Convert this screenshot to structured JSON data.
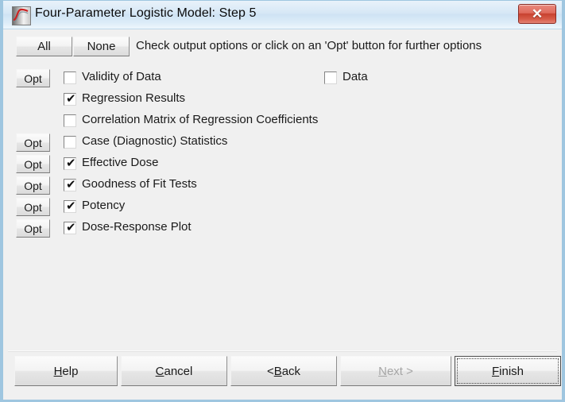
{
  "window": {
    "title": "Four-Parameter Logistic Model: Step 5",
    "icon": "logistic-curve-icon",
    "close_label": "✕"
  },
  "toolbar": {
    "all_label": "All",
    "none_label": "None",
    "hint": "Check output options or click on an 'Opt' button for further options",
    "opt_label": "Opt"
  },
  "options": [
    {
      "opt": true,
      "checked": false,
      "label": "Validity of Data"
    },
    {
      "opt": false,
      "checked": true,
      "label": "Regression Results"
    },
    {
      "opt": false,
      "checked": false,
      "label": "Correlation Matrix of Regression Coefficients"
    },
    {
      "opt": true,
      "checked": false,
      "label": "Case (Diagnostic) Statistics"
    },
    {
      "opt": true,
      "checked": true,
      "label": "Effective Dose"
    },
    {
      "opt": true,
      "checked": true,
      "label": "Goodness of Fit Tests"
    },
    {
      "opt": true,
      "checked": true,
      "label": "Potency"
    },
    {
      "opt": true,
      "checked": true,
      "label": "Dose-Response Plot"
    }
  ],
  "right_option": {
    "checked": false,
    "label": "Data"
  },
  "footer": {
    "help": {
      "pre": "",
      "mn": "H",
      "post": "elp",
      "disabled": false
    },
    "cancel": {
      "pre": "",
      "mn": "C",
      "post": "ancel",
      "disabled": false
    },
    "back": {
      "pre": "< ",
      "mn": "B",
      "post": "ack",
      "disabled": false
    },
    "next": {
      "pre": "",
      "mn": "N",
      "post": "ext >",
      "disabled": true
    },
    "finish": {
      "pre": "",
      "mn": "F",
      "post": "inish",
      "disabled": false
    }
  },
  "colors": {
    "accent_titlebar": "#cfe3f4",
    "window_border": "#9fc6e0",
    "close_button": "#c7412f",
    "client_background": "#f0f0f0",
    "disabled_text": "#a6a6a6"
  }
}
